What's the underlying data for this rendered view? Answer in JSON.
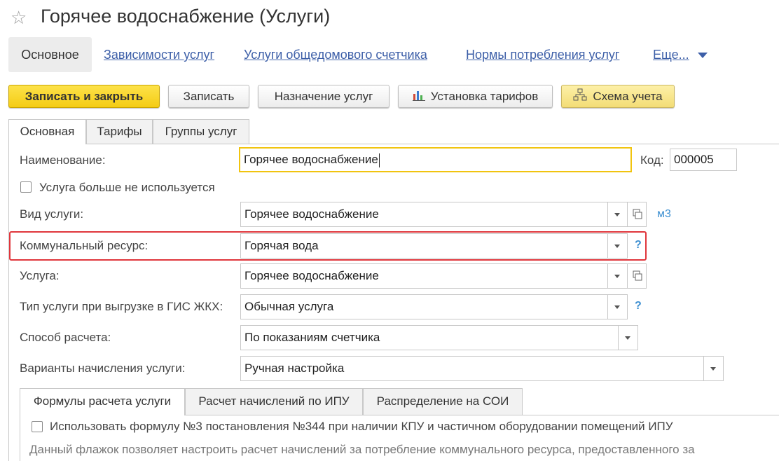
{
  "window": {
    "title": "Горячее водоснабжение (Услуги)"
  },
  "nav": {
    "tabs": [
      "Основное",
      "Зависимости услуг",
      "Услуги общедомового счетчика",
      "Нормы потребления услуг",
      "Еще..."
    ]
  },
  "toolbar": {
    "save_close": "Записать и закрыть",
    "save": "Записать",
    "assign": "Назначение услуг",
    "tariffs": "Установка тарифов",
    "scheme": "Схема учета"
  },
  "form_tabs": [
    "Основная",
    "Тарифы",
    "Группы услуг"
  ],
  "fields": {
    "name_label": "Наименование:",
    "name_value": "Горячее водоснабжение",
    "code_label": "Код:",
    "code_value": "000005",
    "unused_label": "Услуга больше не используется",
    "kind_label": "Вид услуги:",
    "kind_value": "Горячее водоснабжение",
    "kind_unit": "м3",
    "resource_label": "Коммунальный ресурс:",
    "resource_value": "Горячая вода",
    "service_label": "Услуга:",
    "service_value": "Горячее водоснабжение",
    "gis_label": "Тип услуги при выгрузке в ГИС ЖКХ:",
    "gis_value": "Обычная услуга",
    "calc_label": "Способ расчета:",
    "calc_value": "По показаниям счетчика",
    "variants_label": "Варианты начисления услуги:",
    "variants_value": "Ручная настройка",
    "help_mark": "?"
  },
  "sub_tabs": [
    "Формулы расчета услуги",
    "Расчет начислений по ИПУ",
    "Распределение на СОИ"
  ],
  "formula": {
    "checkbox_label": "Использовать формулу №3 постановления №344 при наличии КПУ и частичном оборудовании помещений ИПУ",
    "description": "Данный флажок позволяет настроить расчет начислений за потребление коммунального ресурса, предоставленного за"
  },
  "colors": {
    "accent_yellow": "#f4cc14",
    "link_blue": "#3d5fa8",
    "highlight_red": "#e0363c"
  }
}
